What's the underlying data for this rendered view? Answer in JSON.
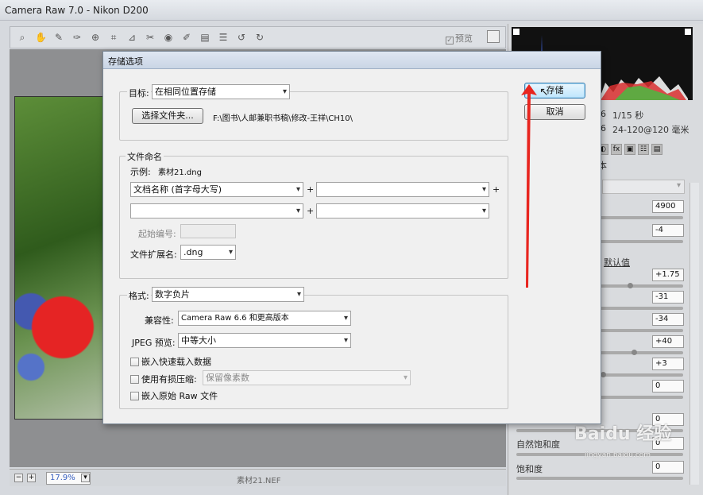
{
  "window": {
    "title": "Camera Raw 7.0 -  Nikon D200"
  },
  "toolbar": {
    "tools": [
      "zoom-tool-icon",
      "hand-tool-icon",
      "white-balance-tool-icon",
      "color-sampler-tool-icon",
      "target-adjust-tool-icon",
      "crop-tool-icon",
      "straighten-tool-icon",
      "spot-removal-tool-icon",
      "red-eye-tool-icon",
      "adjustment-brush-icon",
      "graduated-filter-icon",
      "preferences-icon",
      "rotate-ccw-icon",
      "rotate-cw-icon"
    ],
    "tool_glyphs": [
      "⌕",
      "✋",
      "✎",
      "✑",
      "⊕",
      "⌗",
      "⊿",
      "✂",
      "◉",
      "✐",
      "▤",
      "☰",
      "↺",
      "↻"
    ],
    "preview_label": "预览"
  },
  "status": {
    "zoom": "17.9%",
    "filename": "素材21.NEF"
  },
  "camera_info": {
    "shutter": "1/15 秒",
    "lens": "24-120@120 毫米",
    "digit_a": "6",
    "digit_b": "6"
  },
  "right_panel": {
    "tab_fragment": "本",
    "default_link": "默认值",
    "fields": [
      "4900",
      "-4",
      "+1.75",
      "-31",
      "-34",
      "+40",
      "+3",
      "0",
      "0",
      "0",
      "0"
    ],
    "labels": {
      "vibrance": "自然饱和度",
      "saturation": "饱和度"
    }
  },
  "dialog": {
    "title": "存储选项",
    "target_label": "目标:",
    "target_value": "在相同位置存储",
    "choose_folder": "选择文件夹...",
    "path": "F:\\图书\\人邮兼职书稿\\修改-王祥\\CH10\\",
    "save_button": "存储",
    "cancel_button": "取消",
    "naming_group": "文件命名",
    "example_label": "示例:",
    "example_value": "素材21.dng",
    "name_select_1": "文档名称 (首字母大写)",
    "name_select_2": "",
    "name_select_3": "",
    "name_select_4": "",
    "plus": "+",
    "start_number_label": "起始编号:",
    "start_number_value": "",
    "ext_label": "文件扩展名:",
    "ext_value": ".dng",
    "format_label": "格式:",
    "format_value": "数字负片",
    "compat_label": "兼容性:",
    "compat_value": "Camera Raw 6.6 和更高版本",
    "jpeg_label": "JPEG 预览:",
    "jpeg_value": "中等大小",
    "embed_fast": "嵌入快速载入数据",
    "lossy": "使用有损压缩:",
    "lossy_value": "保留像素数",
    "embed_raw": "嵌入原始 Raw 文件"
  },
  "watermark": {
    "text": "Baidu 经验",
    "sub": "jingyan.baidu.com"
  },
  "colors": {
    "accent": "#e8251f",
    "dialog_bg": "#f0f0f0",
    "title_bg": "#c9d5e5"
  }
}
